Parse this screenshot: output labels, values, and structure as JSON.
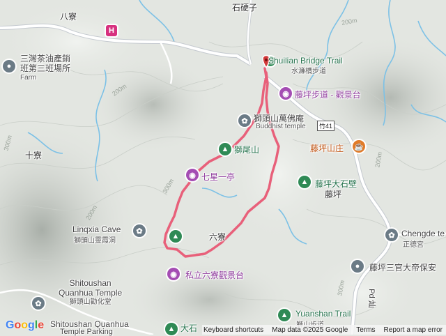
{
  "map": {
    "places": {
      "shijingzi": "石硬子",
      "bazhang": "八寮",
      "shiliao": "十寮",
      "liuliao": "六寮",
      "tengping": "藤坪"
    },
    "pois": {
      "sanwan_tea": [
        "三灣茶油產銷",
        "班第三班場所"
      ],
      "sanwan_tea_sub": "Farm",
      "shuilian_bridge": "Shuilian Bridge Trail",
      "shuilian_bridge_cn": "水濂橋步道",
      "tengping_trail": "藤坪步道 - 觀景台",
      "wanfo": "獅頭山萬佛庵",
      "wanfo_sub": "Buddhist temple",
      "shitoushan": "獅尾山",
      "qixing": "七星一亭",
      "tengping_shanzhuang": "藤坪山庄",
      "tengping_dashibi": "藤坪大石壁",
      "linqia": "Linqxia Cave",
      "linqia_cn": "獅頭山靈霞洞",
      "liuliao_view": "私立六寮觀景台",
      "shitoushan_quan": [
        "Shitoushan",
        "Quanhua Temple"
      ],
      "shitoushan_quan_cn": "獅頭山勸化堂",
      "parking": "Shitoushan Quanhua",
      "parking2": "Temple Parking",
      "chengde": "Chengde te",
      "chengde_cn": "正德宮",
      "tengping_sanguan": "藤坪三官大帝保安",
      "yuanshan": "Yuanshan Trail",
      "yuanshan_cn": "獅山步道",
      "dashi_partial": "大石"
    },
    "road": {
      "shield": "竹41",
      "road_label": "Pd 灿"
    },
    "contours": {
      "c1": "200m",
      "c2": "200m",
      "c3": "200m",
      "c4": "300m",
      "c5": "300m",
      "c6": "300m",
      "c7": "200m"
    }
  },
  "attribution": {
    "logo": "Google",
    "shortcuts": "Keyboard shortcuts",
    "mapdata": "Map data ©2025 Google",
    "terms": "Terms",
    "report": "Report a map error"
  },
  "colors": {
    "route": "#e8607a",
    "water": "#7cc1e6",
    "terrain": "#e3e6e1"
  }
}
